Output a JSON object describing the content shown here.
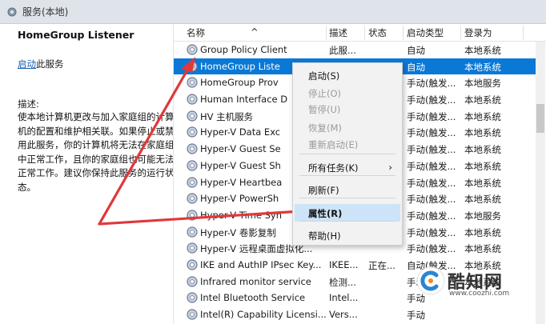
{
  "window": {
    "title": "服务(本地)"
  },
  "left_panel": {
    "service_name": "HomeGroup Listener",
    "start_link": "启动",
    "start_suffix": "此服务",
    "desc_label": "描述:",
    "description": "使本地计算机更改与加入家庭组的计算机的配置和维护相关联。如果停止或禁用此服务，你的计算机将无法在家庭组中正常工作，且你的家庭组也可能无法正常工作。建议你保持此服务的运行状态。"
  },
  "columns": {
    "name": "名称",
    "desc": "描述",
    "status": "状态",
    "start_type": "启动类型",
    "logon": "登录为"
  },
  "rows": [
    {
      "name": "Group Policy Client",
      "desc": "此服...",
      "status": "",
      "start_type": "自动",
      "logon": "本地系统"
    },
    {
      "name": "HomeGroup Liste",
      "desc": "",
      "status": "",
      "start_type": "自动",
      "logon": "本地系统",
      "selected": true
    },
    {
      "name": "HomeGroup Prov",
      "desc": "",
      "status": "",
      "start_type": "手动(触发...",
      "logon": "本地服务"
    },
    {
      "name": "Human Interface D",
      "desc": "",
      "status": "",
      "start_type": "手动(触发...",
      "logon": "本地系统"
    },
    {
      "name": "HV 主机服务",
      "desc": "",
      "status": "",
      "start_type": "手动(触发...",
      "logon": "本地系统"
    },
    {
      "name": "Hyper-V Data Exc",
      "desc": "",
      "status": "",
      "start_type": "手动(触发...",
      "logon": "本地系统"
    },
    {
      "name": "Hyper-V Guest Se",
      "desc": "",
      "status": "",
      "start_type": "手动(触发...",
      "logon": "本地系统"
    },
    {
      "name": "Hyper-V Guest Sh",
      "desc": "",
      "status": "",
      "start_type": "手动(触发...",
      "logon": "本地系统"
    },
    {
      "name": "Hyper-V Heartbea",
      "desc": "",
      "status": "",
      "start_type": "手动(触发...",
      "logon": "本地系统"
    },
    {
      "name": "Hyper-V PowerSh",
      "desc": "",
      "status": "",
      "start_type": "手动(触发...",
      "logon": "本地系统"
    },
    {
      "name": "Hyper-V Time Syn",
      "desc": "",
      "status": "",
      "start_type": "手动(触发...",
      "logon": "本地服务"
    },
    {
      "name": "Hyper-V 卷影复制",
      "desc": "",
      "status": "",
      "start_type": "手动(触发...",
      "logon": "本地系统"
    },
    {
      "name": "Hyper-V 远程桌面虚拟化...",
      "desc": "",
      "status": "",
      "start_type": "手动(触发...",
      "logon": "本地系统"
    },
    {
      "name": "IKE and AuthIP IPsec Key...",
      "desc": "IKEE...",
      "status": "正在...",
      "start_type": "自动(触发...",
      "logon": "本地系统"
    },
    {
      "name": "Infrared monitor service",
      "desc": "检测...",
      "status": "",
      "start_type": "手动",
      "logon": "本地系统"
    },
    {
      "name": "Intel Bluetooth Service",
      "desc": "Intel...",
      "status": "",
      "start_type": "手动",
      "logon": ""
    },
    {
      "name": "Intel(R) Capability Licensi...",
      "desc": "Vers...",
      "status": "",
      "start_type": "手动",
      "logon": ""
    }
  ],
  "context_menu": {
    "items": [
      {
        "label": "启动(S)",
        "disabled": false
      },
      {
        "label": "停止(O)",
        "disabled": true
      },
      {
        "label": "暂停(U)",
        "disabled": true
      },
      {
        "label": "恢复(M)",
        "disabled": true
      },
      {
        "label": "重新启动(E)",
        "disabled": true
      },
      {
        "label": "所有任务(K)",
        "disabled": false,
        "submenu": true
      },
      {
        "label": "刷新(F)",
        "disabled": false
      },
      {
        "label": "属性(R)",
        "disabled": false,
        "highlighted": true
      },
      {
        "label": "帮助(H)",
        "disabled": false
      }
    ],
    "submenu_arrow": "›"
  },
  "watermark": {
    "text": "酷知网",
    "url": "www.coozhi.com"
  },
  "colors": {
    "selection": "#0a78d7",
    "annotation_arrow": "#e0383b",
    "menu_highlight": "#cde3f7"
  }
}
